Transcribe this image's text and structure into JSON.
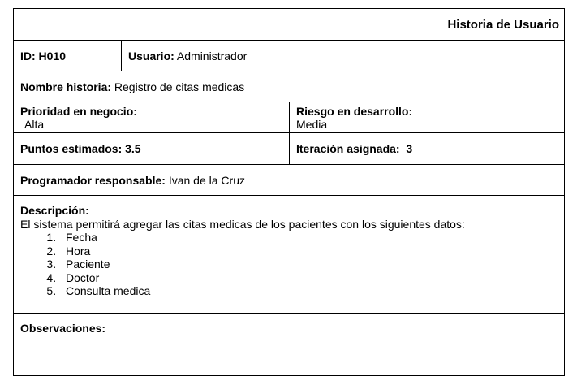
{
  "header": {
    "title": "Historia de Usuario"
  },
  "id_row": {
    "id_label": "ID: H010",
    "user_label": "Usuario:",
    "user_value": " Administrador"
  },
  "story": {
    "name_label": "Nombre historia:",
    "name_value": " Registro de citas medicas"
  },
  "priority": {
    "label": "Prioridad en negocio:",
    "value": "Alta"
  },
  "risk": {
    "label": "Riesgo en desarrollo:",
    "value": "Media"
  },
  "points": {
    "label": "Puntos estimados: 3.5"
  },
  "iteration": {
    "label": "Iteración asignada:  3"
  },
  "programmer": {
    "label": "Programador responsable:",
    "value": " Ivan de la Cruz"
  },
  "description": {
    "label": "Descripción:",
    "text": "El sistema permitirá agregar las citas medicas de los pacientes con los siguientes datos:",
    "items": [
      "Fecha",
      "Hora",
      "Paciente",
      "Doctor",
      "Consulta medica"
    ]
  },
  "observations": {
    "label": "Observaciones:"
  }
}
